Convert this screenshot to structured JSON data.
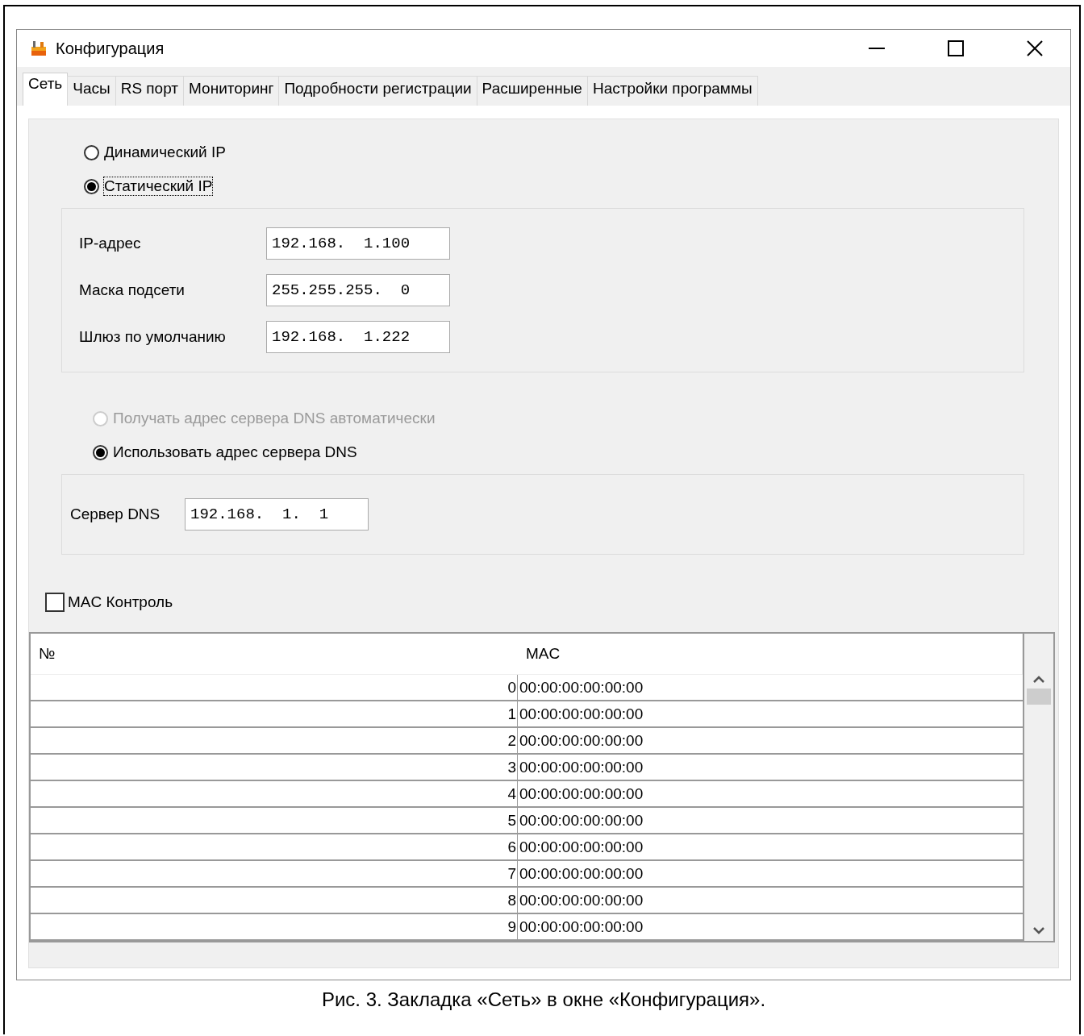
{
  "window": {
    "title": "Конфигурация"
  },
  "tabs": [
    {
      "label": "Сеть",
      "selected": true
    },
    {
      "label": "Часы",
      "selected": false
    },
    {
      "label": "RS порт",
      "selected": false
    },
    {
      "label": "Мониторинг",
      "selected": false
    },
    {
      "label": "Подробности регистрации",
      "selected": false
    },
    {
      "label": "Расширенные",
      "selected": false
    },
    {
      "label": "Настройки программы",
      "selected": false
    }
  ],
  "ip_mode": [
    {
      "label": "Динамический IP",
      "selected": false,
      "focused": false
    },
    {
      "label": "Статический IP",
      "selected": true,
      "focused": true
    }
  ],
  "ip_settings": [
    {
      "label": "IP-адрес",
      "value": "192.168.  1.100"
    },
    {
      "label": "Маска подсети",
      "value": "255.255.255.  0"
    },
    {
      "label": "Шлюз по умолчанию",
      "value": "192.168.  1.222"
    }
  ],
  "dns_mode": [
    {
      "label": "Получать адрес сервера DNS автоматически",
      "selected": false,
      "disabled": true
    },
    {
      "label": "Использовать адрес сервера DNS",
      "selected": true,
      "disabled": false
    }
  ],
  "dns_server": {
    "label": "Сервер DNS",
    "value": "192.168.  1.  1"
  },
  "mac_control": {
    "label": "MAC Контроль",
    "checked": false
  },
  "table": {
    "columns": [
      "№",
      "MAC"
    ],
    "rows": [
      [
        "0",
        "00:00:00:00:00:00"
      ],
      [
        "1",
        "00:00:00:00:00:00"
      ],
      [
        "2",
        "00:00:00:00:00:00"
      ],
      [
        "3",
        "00:00:00:00:00:00"
      ],
      [
        "4",
        "00:00:00:00:00:00"
      ],
      [
        "5",
        "00:00:00:00:00:00"
      ],
      [
        "6",
        "00:00:00:00:00:00"
      ],
      [
        "7",
        "00:00:00:00:00:00"
      ],
      [
        "8",
        "00:00:00:00:00:00"
      ],
      [
        "9",
        "00:00:00:00:00:00"
      ]
    ]
  },
  "caption": "Рис. 3. Закладка «Сеть» в окне «Конфигурация»."
}
